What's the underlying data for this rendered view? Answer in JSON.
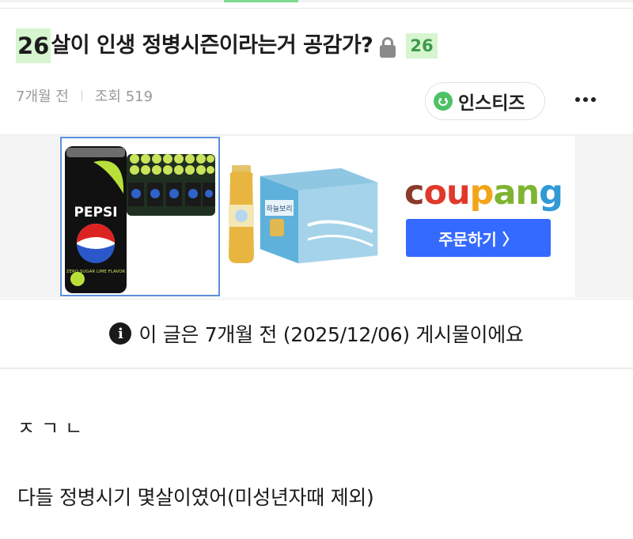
{
  "post": {
    "title_number": "26",
    "title_text": "살이 인생 정병시즌이라는거 공감가?",
    "title_badge": "26",
    "time_ago": "7개월 전",
    "views_label": "조회 519"
  },
  "board": {
    "name": "인스티즈"
  },
  "ad": {
    "brand_text": "coupang",
    "brand_letters": [
      "c",
      "ou",
      "p",
      "an",
      "g"
    ],
    "brand_colors": [
      "#8b3a2b",
      "#e0392b",
      "#f2a516",
      "#7fb431",
      "#2f9ad6"
    ],
    "order_button_label": "주문하기 〉",
    "button_color": "#346aff",
    "product1_label": "PEPSI",
    "product1_sub": "ZERO SUGAR LIME FLAVOR",
    "product2_label": "하늘보리"
  },
  "notice": {
    "text": "이 글은 7개월 전 (2025/12/06) 게시물이에요"
  },
  "content": {
    "line1": "ㅈㄱㄴ",
    "line2": "다들 정병시기 몇살이였어(미성년자때 제외)"
  },
  "colors": {
    "highlight_bg": "#d6f5cf",
    "highlight_text": "#3d9a4b",
    "accent_green": "#4cc265"
  }
}
